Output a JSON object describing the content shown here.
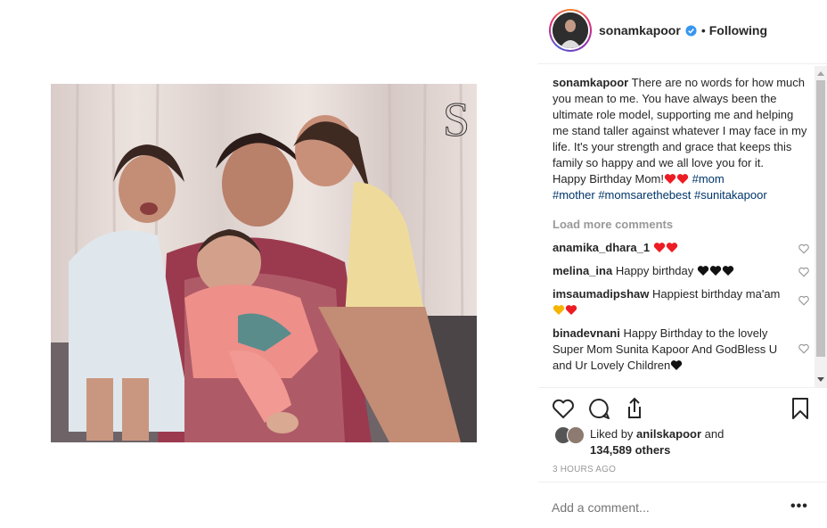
{
  "post": {
    "username": "sonamkapoor",
    "verified": true,
    "follow_status": "Following",
    "separator": "•"
  },
  "caption": {
    "username": "sonamkapoor",
    "text": "There are no words for how much you mean to me. You have always been the ultimate role model, supporting me and helping me stand taller against whatever I may face in my life. It's your strength and grace that keeps this family so happy and we all love you for it.",
    "line2": "Happy Birthday Mom!",
    "hashtags": [
      "#mom",
      "#mother",
      "#momsarethebest",
      "#sunitakapoor"
    ]
  },
  "load_more": "Load more comments",
  "comments": [
    {
      "username": "anamika_dhara_1",
      "text": "",
      "emoji": [
        "red-heart",
        "red-heart"
      ]
    },
    {
      "username": "melina_ina",
      "text": "Happy birthday",
      "emoji": [
        "black-heart",
        "black-heart",
        "black-heart"
      ]
    },
    {
      "username": "imsaumadipshaw",
      "text": "Happiest birthday ma'am",
      "emoji": [
        "yellow-heart",
        "red-heart"
      ]
    },
    {
      "username": "binadevnani",
      "text": "Happy Birthday to the lovely Super Mom Sunita Kapoor And GodBless U and Ur Lovely Children",
      "emoji": [
        "black-heart"
      ]
    }
  ],
  "likes": {
    "prefix": "Liked by",
    "user": "anilskapoor",
    "conj": "and",
    "count": "134,589 others"
  },
  "timestamp": "3 HOURS AGO",
  "add_comment": {
    "placeholder": "Add a comment..."
  },
  "more_options": "•••",
  "photo": {
    "watermark": "S"
  },
  "colors": {
    "link": "#003569",
    "muted": "#999999",
    "text": "#262626",
    "verified": "#3897f0",
    "heart_red": "#ed1c24"
  }
}
